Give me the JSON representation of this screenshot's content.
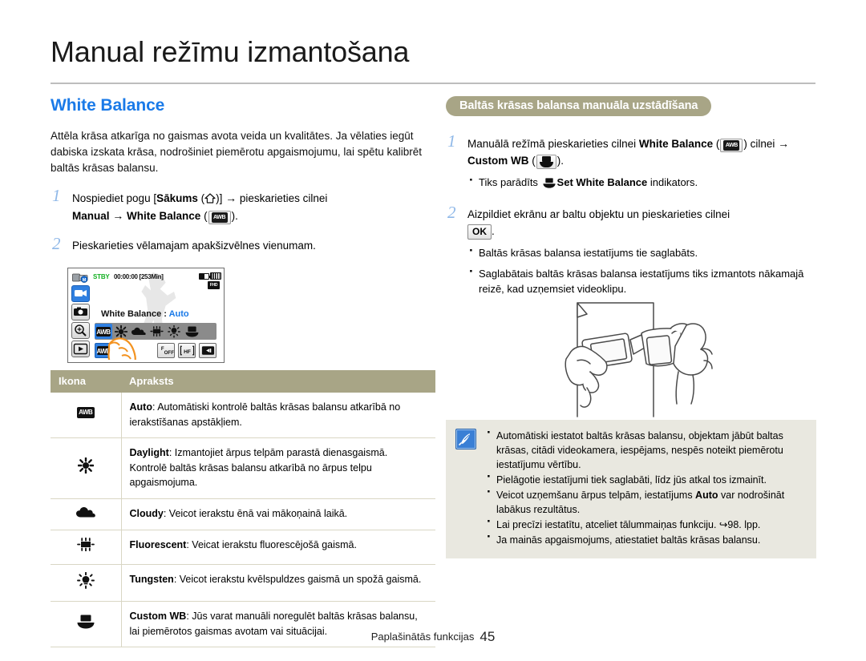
{
  "page": {
    "title": "Manual režīmu izmantošana",
    "footer_label": "Paplašinātās funkcijas",
    "footer_page": "45"
  },
  "left": {
    "section_title": "White Balance",
    "intro": "Attēla krāsa atkarīga no gaismas avota veida un kvalitātes. Ja vēlaties iegūt dabiska izskata krāsa, nodrošiniet piemērotu apgaismojumu, lai spētu kalibrēt baltās krāsas balansu.",
    "step1_num": "1",
    "step1_a": "Nospiediet pogu [",
    "step1_b": "Sākums",
    "step1_c": " (",
    "step1_d": ")] ",
    "step1_arrow": "→",
    "step1_e": " pieskarieties cilnei",
    "step1_f": "Manual",
    "step1_g": "White Balance",
    "step1_h": ").",
    "step2_num": "2",
    "step2_text": "Pieskarieties vēlamajam apakšizvēlnes vienumam."
  },
  "lcd": {
    "stby": "STBY",
    "timecode": "00:00:00 [253Min]",
    "hd_label": "FULL HD",
    "title_label": "White Balance :",
    "title_value": "Auto",
    "wb_icons": [
      "awb",
      "daylight",
      "cloudy",
      "fluorescent",
      "tungsten",
      "customwb"
    ],
    "row2_icons": [
      "awb",
      "blank",
      "blank",
      "fade-off",
      "anti-shake",
      "back"
    ]
  },
  "table": {
    "headers": [
      "Ikona",
      "Apraksts"
    ],
    "rows": [
      {
        "icon": "awb-icon",
        "name": "Auto",
        "desc": ": Automātiski kontrolē baltās krāsas balansu atkarībā no ierakstīšanas apstākļiem."
      },
      {
        "icon": "daylight-icon",
        "name": "Daylight",
        "desc": ": Izmantojiet ārpus telpām parastā dienasgaismā. Kontrolē baltās krāsas balansu atkarībā no ārpus telpu apgaismojuma."
      },
      {
        "icon": "cloudy-icon",
        "name": "Cloudy",
        "desc": ": Veicot ierakstu ēnā vai mākoņainā laikā."
      },
      {
        "icon": "fluorescent-icon",
        "name": "Fluorescent",
        "desc": ": Veicat ierakstu fluorescējošā gaismā."
      },
      {
        "icon": "tungsten-icon",
        "name": "Tungsten",
        "desc": ": Veicot ierakstu kvēlspuldzes gaismā un spožā gaismā."
      },
      {
        "icon": "customwb-icon",
        "name": "Custom WB",
        "desc": ": Jūs varat manuāli noregulēt baltās krāsas balansu, lai piemērotos gaismas avotam vai situācijai."
      }
    ]
  },
  "right": {
    "banner": "Baltās krāsas balansa manuāla uzstādīšana",
    "step1_num": "1",
    "step1_a": "Manuālā režīmā pieskarieties cilnei ",
    "step1_b": "White Balance",
    "step1_c": ") cilnei ",
    "step1_arrow": "→",
    "step1_d": "Custom WB",
    "step1_e": ").",
    "step1_bullet_a": "Tiks parādīts ",
    "step1_bullet_b": "Set White Balance",
    "step1_bullet_c": " indikators.",
    "step2_num": "2",
    "step2_a": "Aizpildiet ekrānu ar baltu objektu un pieskarieties cilnei",
    "step2_ok": "OK",
    "step2_b": ".",
    "step2_bullets": [
      "Baltās krāsas balansa iestatījums tie saglabāts.",
      "Saglabātais baltās krāsas balansa iestatījums tiks izmantots nākamajā reizē, kad uzņemsiet videoklipu."
    ]
  },
  "note": {
    "items": [
      {
        "pre": "Automātiski iestatot baltās krāsas balansu, objektam jābūt baltas krāsas, citādi videokamera, iespējams, nespēs noteikt piemērotu iestatījumu vērtību.",
        "bold": "",
        "post": ""
      },
      {
        "pre": "Pielāgotie iestatījumi tiek saglabāti, līdz jūs atkal tos izmainīt.",
        "bold": "",
        "post": ""
      },
      {
        "pre": "Veicot uzņemšanu ārpus telpām, iestatījums ",
        "bold": "Auto",
        "post": " var nodrošināt labākus rezultātus."
      },
      {
        "pre": "Lai precīzi iestatītu, atceliet tālummaiņas funkciju. ↪98. lpp.",
        "bold": "",
        "post": ""
      },
      {
        "pre": "Ja mainās apgaismojums, atiestatiet baltās krāsas balansu.",
        "bold": "",
        "post": ""
      }
    ]
  },
  "colors": {
    "accent_blue": "#1a7ae8",
    "olive": "#a8a586",
    "note_bg": "#e9e8e0",
    "stby_green": "#12b021"
  }
}
